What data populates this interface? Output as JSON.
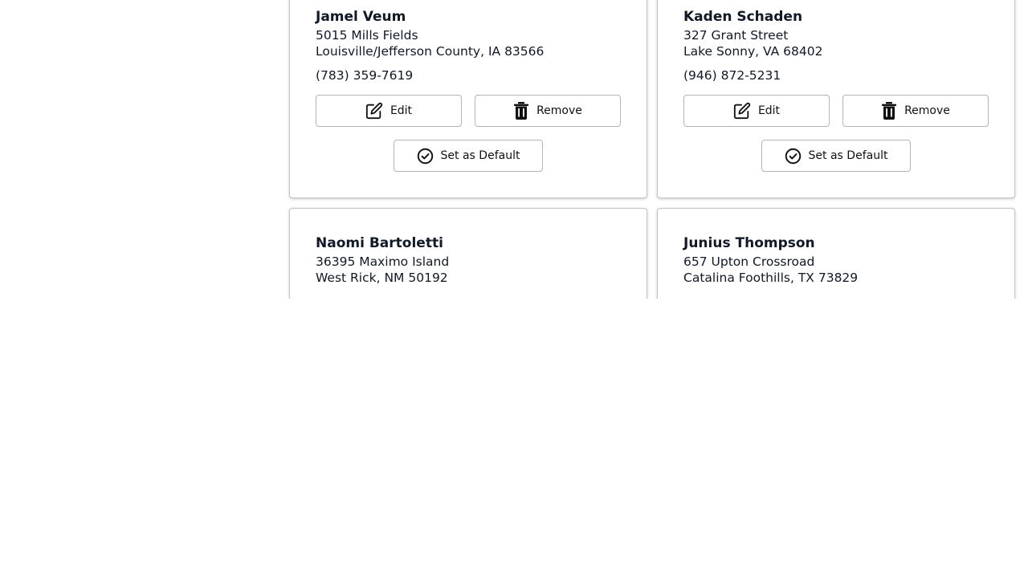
{
  "buttons": {
    "edit_label": "Edit",
    "remove_label": "Remove",
    "default_label": "Set as Default"
  },
  "addresses": [
    {
      "name": "Jamel Veum",
      "street": "5015 Mills Fields",
      "city_line": "Louisville/Jefferson County, IA 83566",
      "phone": "(783) 359-7619"
    },
    {
      "name": "Kaden Schaden",
      "street": "327 Grant Street",
      "city_line": "Lake Sonny, VA 68402",
      "phone": "(946) 872-5231"
    },
    {
      "name": "Naomi Bartoletti",
      "street": "36395 Maximo Island",
      "city_line": "West Rick, NM 50192",
      "phone": ""
    },
    {
      "name": "Junius Thompson",
      "street": "657 Upton Crossroad",
      "city_line": "Catalina Foothills, TX 73829",
      "phone": ""
    }
  ]
}
